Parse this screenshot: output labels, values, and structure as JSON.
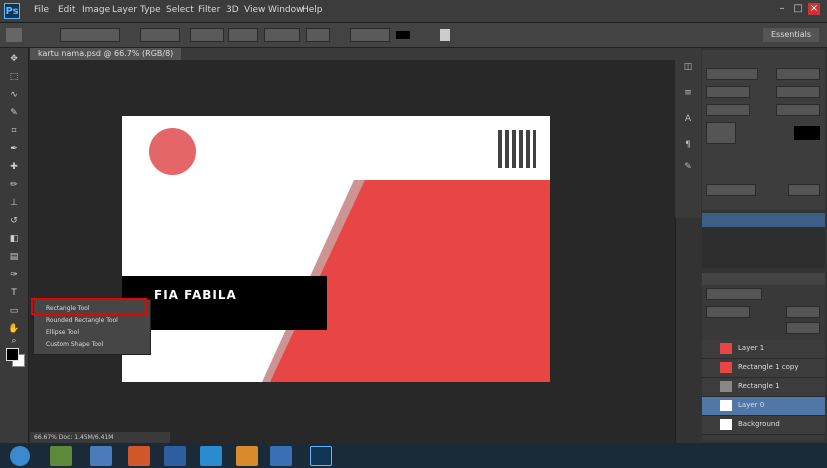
{
  "window": {
    "app_name": "Ps"
  },
  "menu": [
    "File",
    "Edit",
    "Image",
    "Layer",
    "Type",
    "Select",
    "Filter",
    "3D",
    "View",
    "Window",
    "Help"
  ],
  "options_bar": {
    "workspace": "Essentials"
  },
  "document_tab": "kartu nama.psd @ 66.7% (RGB/8)",
  "card": {
    "name": "FIA FABILA"
  },
  "tool_flyout": {
    "items": [
      "Rectangle Tool",
      "Rounded Rectangle Tool",
      "Ellipse Tool",
      "Custom Shape Tool"
    ],
    "highlighted_index": 0
  },
  "layers": [
    "Layer 1",
    "Rectangle 1 copy",
    "Rectangle 1",
    "Layer 0",
    "Background"
  ],
  "status_bar": "66.67%  Doc: 1.45M/6.41M",
  "colors": {
    "card_red": "#e84545",
    "highlight": "#ff0000"
  }
}
